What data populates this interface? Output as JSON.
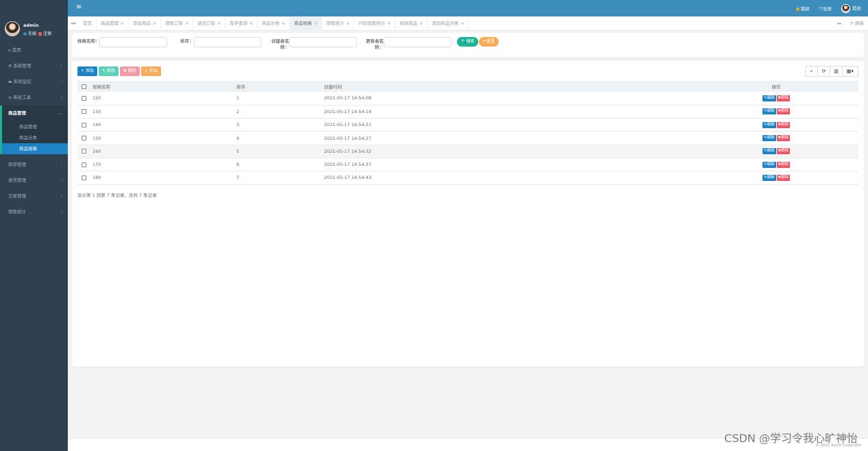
{
  "user": {
    "name": "admin",
    "status": "在线",
    "logout": "注销"
  },
  "sidebar": {
    "items": [
      {
        "icon": "⌂",
        "label": "首页",
        "arrow": ""
      },
      {
        "icon": "⚙",
        "label": "系统管理",
        "arrow": "‹"
      },
      {
        "icon": "▬",
        "label": "系统监控",
        "arrow": "‹"
      },
      {
        "icon": "≡",
        "label": "系统工具",
        "arrow": "‹"
      }
    ],
    "open_group": {
      "label": "商品管理",
      "arrow": "⌄",
      "subs": [
        "商品管理",
        "商品分类",
        "商品规格"
      ]
    },
    "items_after": [
      {
        "label": "库存管理",
        "arrow": "‹"
      },
      {
        "label": "进货管理",
        "arrow": "‹"
      },
      {
        "label": "交易管理",
        "arrow": "‹"
      },
      {
        "label": "销售统计",
        "arrow": "‹"
      }
    ]
  },
  "topbar": {
    "menu_icon": "≡",
    "lock": "🔒锁屏",
    "fullscreen": "⤧全屏",
    "user": "若依"
  },
  "tabs": {
    "left_nav": "◂◂",
    "items": [
      {
        "label": "首页",
        "closable": false
      },
      {
        "label": "商品管理",
        "closable": true
      },
      {
        "label": "添加商品",
        "closable": true
      },
      {
        "label": "销售订单",
        "closable": true
      },
      {
        "label": "退货订单",
        "closable": true
      },
      {
        "label": "库存查询",
        "closable": true
      },
      {
        "label": "商品分类",
        "closable": true
      },
      {
        "label": "商品规格",
        "closable": true,
        "active": true
      },
      {
        "label": "销售统计",
        "closable": true
      },
      {
        "label": "尺码销售统计",
        "closable": true
      },
      {
        "label": "修改商品",
        "closable": true
      },
      {
        "label": "添加商品分类",
        "closable": true
      }
    ],
    "right_nav": "▸▸",
    "refresh": "⟳ 刷新"
  },
  "search": {
    "name_label": "规格名称：",
    "sort_label": "排序：",
    "creator_label_1": "创建者名",
    "creator_label_2": "称：",
    "updater_label_1": "更新者名",
    "updater_label_2": "称：",
    "search_btn": "🔍搜索",
    "reset_btn": "⟳重置"
  },
  "toolbar": {
    "add": "+ 添加",
    "edit": "✎ 修改",
    "delete": "✖ 删除",
    "export": "⇩ 导出"
  },
  "table": {
    "headers": {
      "name": "规格名称",
      "sort": "排序",
      "time": "创建时间",
      "op": "操作"
    },
    "rows": [
      {
        "name": "120",
        "sort": "1",
        "time": "2021-05-17 14:54:08"
      },
      {
        "name": "130",
        "sort": "2",
        "time": "2021-05-17 14:54:14"
      },
      {
        "name": "140",
        "sort": "3",
        "time": "2021-05-17 14:54:21"
      },
      {
        "name": "150",
        "sort": "4",
        "time": "2021-05-17 14:54:27"
      },
      {
        "name": "160",
        "sort": "5",
        "time": "2021-05-17 14:54:32"
      },
      {
        "name": "170",
        "sort": "6",
        "time": "2021-05-17 14:54:37"
      },
      {
        "name": "180",
        "sort": "7",
        "time": "2021-05-17 14:54:43"
      }
    ],
    "edit_btn": "✎编辑",
    "delete_btn": "✖删除"
  },
  "pagination": {
    "info": "显示第 1 到第 7 条记录，总共 7 条记录"
  },
  "footer": {
    "copyright": "© 2021 RuoYi Copyright"
  },
  "watermark": "CSDN @学习令我心旷神怡"
}
